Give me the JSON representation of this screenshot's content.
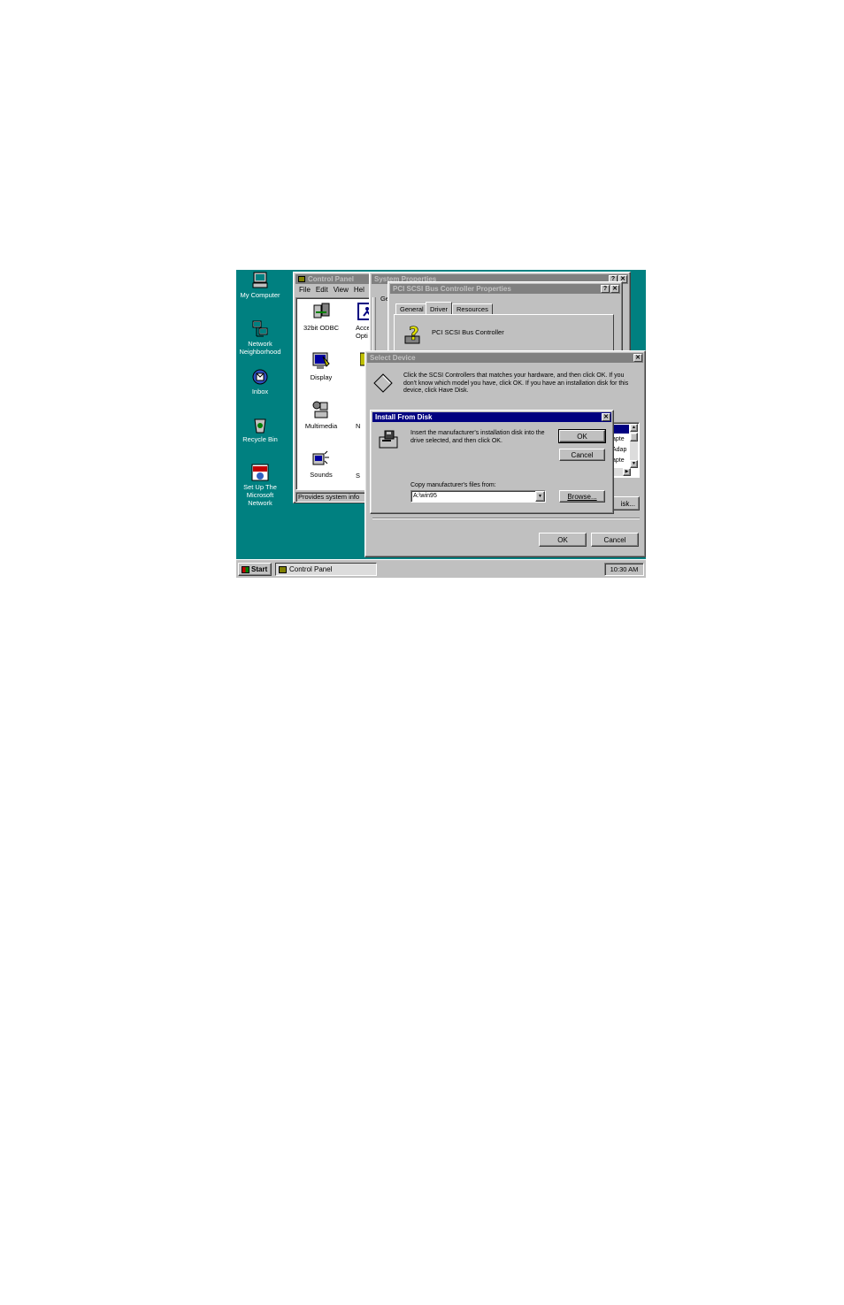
{
  "desktop": {
    "icons": [
      {
        "label": "My Computer"
      },
      {
        "label": "Network Neighborhood"
      },
      {
        "label": "Inbox"
      },
      {
        "label": "Recycle Bin"
      },
      {
        "label": "Set Up The Microsoft Network"
      }
    ]
  },
  "control_panel": {
    "title": "Control Panel",
    "menu": [
      "File",
      "Edit",
      "View",
      "Hel"
    ],
    "icons": [
      {
        "label": "32bit ODBC"
      },
      {
        "label": "Acces Opti"
      },
      {
        "label": "Display"
      },
      {
        "label": "Multimedia"
      },
      {
        "label": "N"
      },
      {
        "label": "Sounds"
      },
      {
        "label": "S"
      }
    ],
    "status": "Provides system info"
  },
  "system_properties": {
    "title": "System Properties",
    "tab_fragment": "Ge"
  },
  "pci_props": {
    "title": "PCI SCSI Bus Controller Properties",
    "tabs": [
      "General",
      "Driver",
      "Resources"
    ],
    "device_name": "PCI SCSI Bus Controller"
  },
  "select_device": {
    "title": "Select Device",
    "instructions": "Click the SCSI Controllers that matches your hardware, and then click OK. If you don't know which model you have, click OK. If you have an installation disk for this device, click Have Disk.",
    "list_fragments": [
      "apte",
      "Adap",
      "apte"
    ],
    "have_disk_fragment": "isk...",
    "ok_label": "OK",
    "cancel_label": "Cancel"
  },
  "install_from_disk": {
    "title": "Install From Disk",
    "message": "Insert the manufacturer's installation disk into the drive selected, and then click OK.",
    "ok_label": "OK",
    "cancel_label": "Cancel",
    "copy_label": "Copy manufacturer's files from:",
    "path_value": "A:\\win95",
    "browse_label": "Browse..."
  },
  "taskbar": {
    "start_label": "Start",
    "task_label": "Control Panel",
    "clock": "10:30 AM"
  },
  "colors": {
    "desktop": "#008080",
    "active_title": "#000080",
    "inactive_title": "#808080",
    "face": "#c0c0c0"
  }
}
